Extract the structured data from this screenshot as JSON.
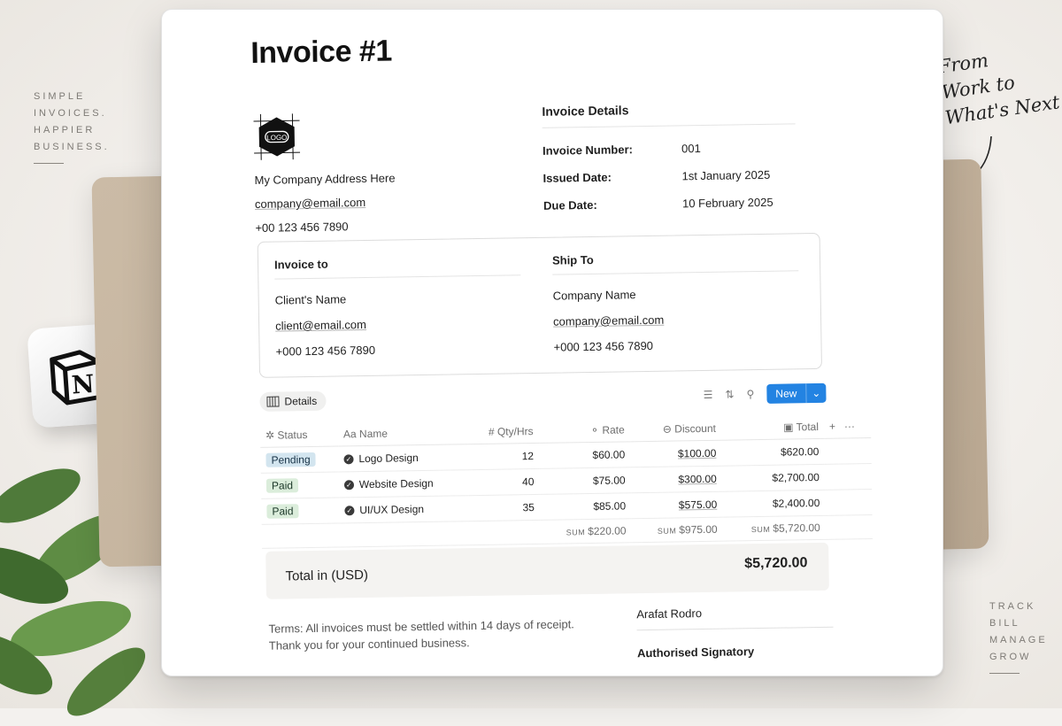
{
  "taglines": {
    "left": [
      "SIMPLE",
      "INVOICES.",
      "HAPPIER",
      "BUSINESS."
    ],
    "right": [
      "TRACK",
      "BILL",
      "MANAGE",
      "GROW"
    ]
  },
  "script_text": [
    "From",
    "Work to",
    "What's Next"
  ],
  "invoice": {
    "title": "Invoice #1",
    "company": {
      "address": "My Company Address Here",
      "email": "company@email.com",
      "phone": "+00 123 456 7890",
      "logo_text": "LOGO"
    },
    "details": {
      "heading": "Invoice Details",
      "number_label": "Invoice Number:",
      "number": "001",
      "issued_label": "Issued Date:",
      "issued": "1st January 2025",
      "due_label": "Due Date:",
      "due": "10 February 2025"
    },
    "invoice_to": {
      "heading": "Invoice to",
      "name": "Client's Name",
      "email": "client@email.com",
      "phone": "+000 123 456 7890"
    },
    "ship_to": {
      "heading": "Ship To",
      "name": "Company Name",
      "email": "company@email.com",
      "phone": "+000 123 456 7890"
    },
    "database": {
      "view_tab": "Details",
      "new_button": "New",
      "columns": {
        "status": "Status",
        "name": "Name",
        "qty": "Qty/Hrs",
        "rate": "Rate",
        "discount": "Discount",
        "total": "Total"
      },
      "rows": [
        {
          "status": "Pending",
          "status_type": "pending",
          "name": "Logo Design",
          "qty": "12",
          "rate": "$60.00",
          "discount": "$100.00",
          "total": "$620.00"
        },
        {
          "status": "Paid",
          "status_type": "paid",
          "name": "Website Design",
          "qty": "40",
          "rate": "$75.00",
          "discount": "$300.00",
          "total": "$2,700.00"
        },
        {
          "status": "Paid",
          "status_type": "paid",
          "name": "UI/UX Design",
          "qty": "35",
          "rate": "$85.00",
          "discount": "$575.00",
          "total": "$2,400.00"
        }
      ],
      "sums": {
        "label": "SUM",
        "rate": "$220.00",
        "discount": "$975.00",
        "total": "$5,720.00"
      }
    },
    "total": {
      "label": "Total in (USD)",
      "value": "$5,720.00"
    },
    "terms": {
      "label": "Terms:",
      "text": " All invoices must be settled within 14 days of receipt. Thank you for your continued business."
    },
    "signature": {
      "name": "Arafat Rodro",
      "role": "Authorised Signatory"
    }
  },
  "colors": {
    "accent": "#2383e2",
    "pending_bg": "#d3e5ef",
    "paid_bg": "#dbeddb",
    "card_tan": "#c4b39d"
  }
}
